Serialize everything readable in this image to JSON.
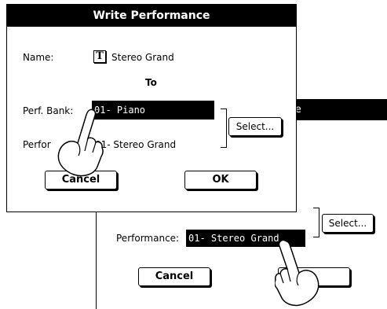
{
  "dialog": {
    "title": "Write Performance",
    "name_label": "Name:",
    "name_icon": "T",
    "name_value": "Stereo Grand",
    "to_label": "To",
    "bank_label": "Perf. Bank:",
    "bank_value": "01- Piano",
    "performance_label": "Perfor",
    "performance_value": "01- Stereo Grand",
    "select_label": "Select...",
    "cancel_label": "Cancel",
    "ok_label": "OK"
  },
  "back_dialog": {
    "title_fragment": "e",
    "select_label": "Select...",
    "performance_label": "Performance:",
    "performance_value": "01- Stereo Grand",
    "cancel_label": "Cancel"
  },
  "icons": [
    "pointing-hand-icon"
  ]
}
